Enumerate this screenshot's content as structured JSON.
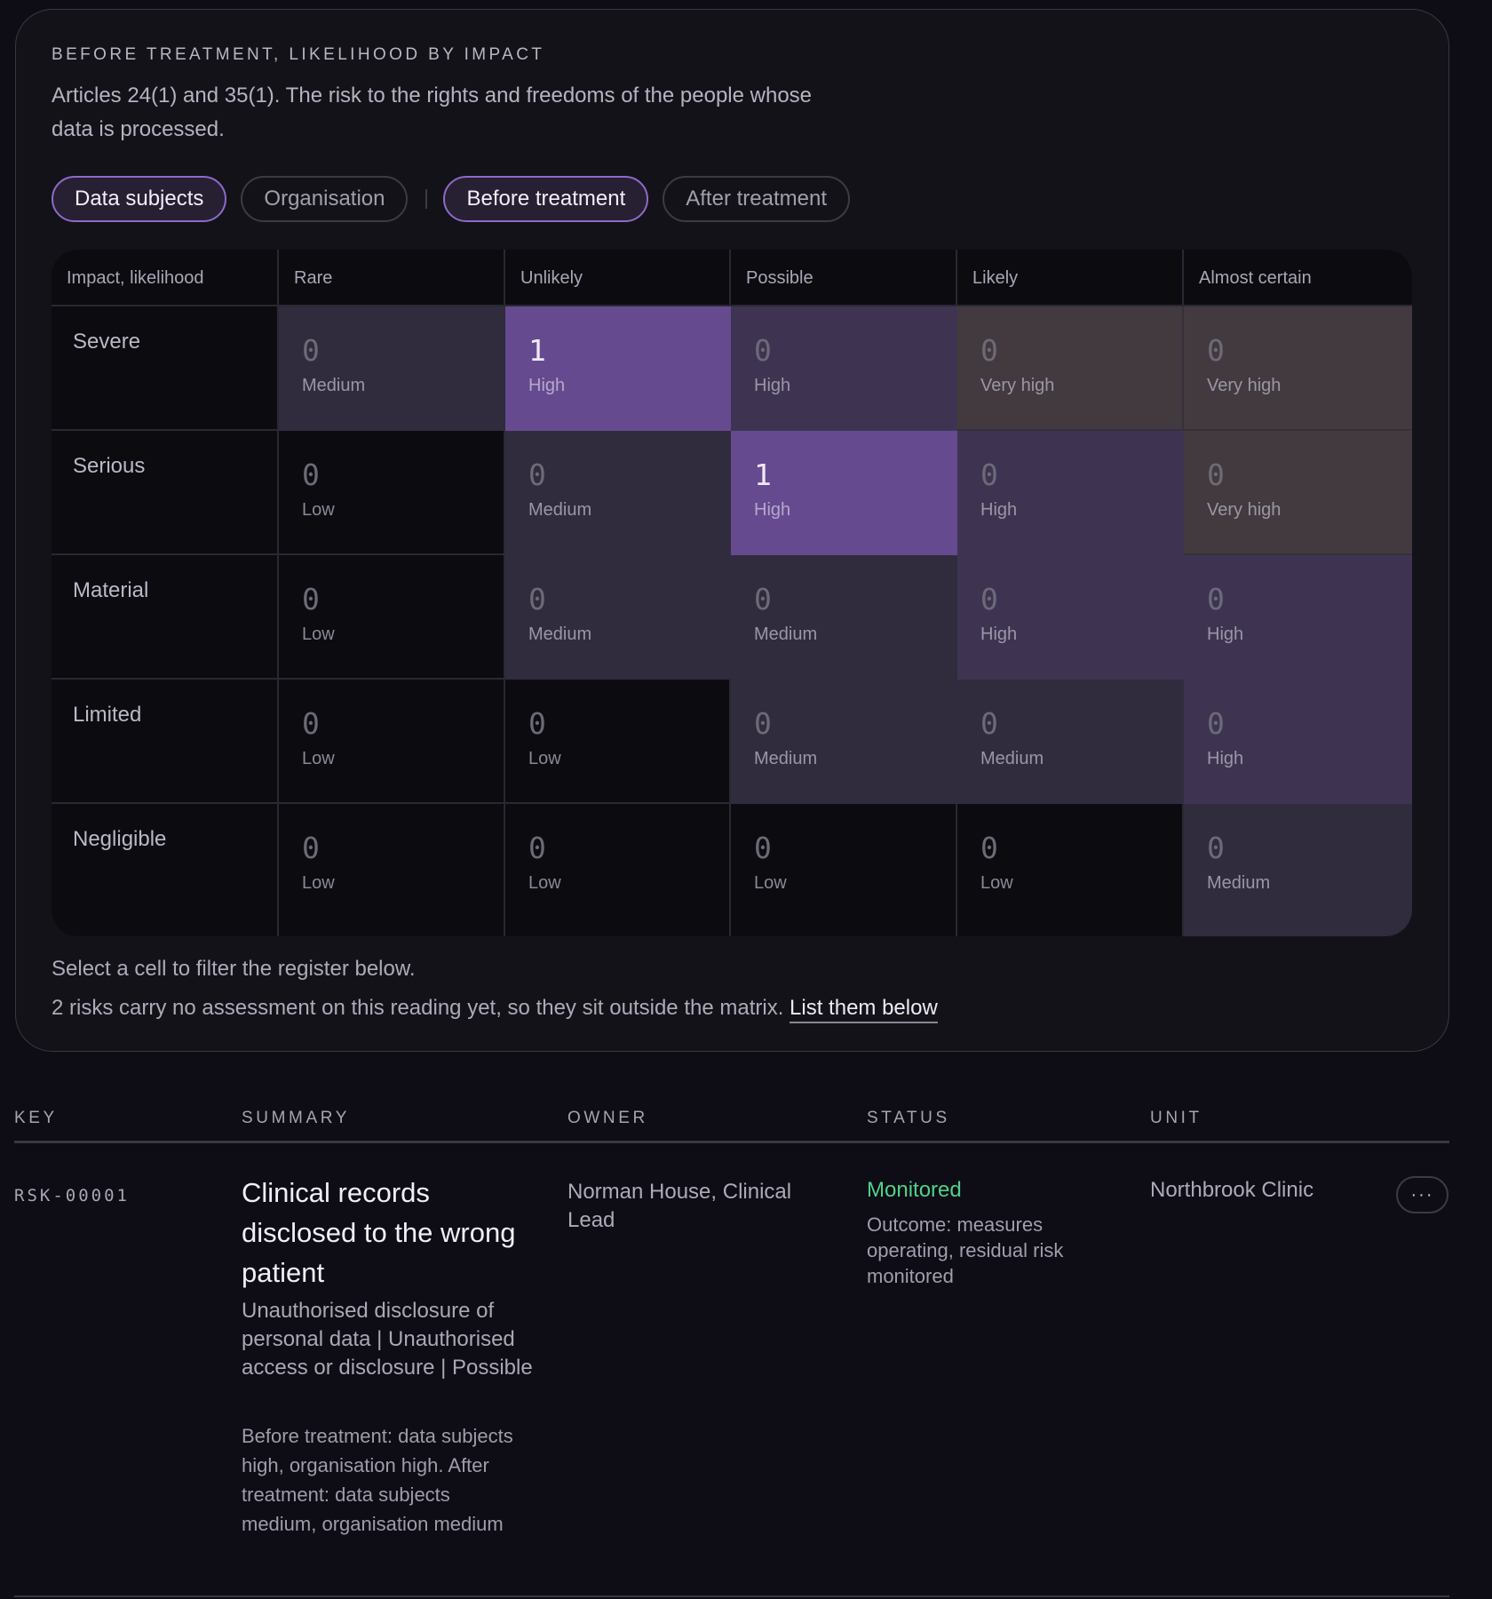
{
  "matrix_panel": {
    "eyebrow": "BEFORE TREATMENT, LIKELIHOOD BY IMPACT",
    "description": "Articles 24(1) and 35(1). The risk to the rights and freedoms of the people whose data is processed.",
    "pills": {
      "data_subjects": "Data subjects",
      "organisation": "Organisation",
      "before_treatment": "Before treatment",
      "after_treatment": "After treatment"
    },
    "corner_header": "Impact, likelihood",
    "columns": [
      "Rare",
      "Unlikely",
      "Possible",
      "Likely",
      "Almost certain"
    ],
    "rows": [
      {
        "impact": "Severe",
        "cells": [
          {
            "count": "0",
            "level": "Medium"
          },
          {
            "count": "1",
            "level": "High"
          },
          {
            "count": "0",
            "level": "High"
          },
          {
            "count": "0",
            "level": "Very high"
          },
          {
            "count": "0",
            "level": "Very high"
          }
        ]
      },
      {
        "impact": "Serious",
        "cells": [
          {
            "count": "0",
            "level": "Low"
          },
          {
            "count": "0",
            "level": "Medium"
          },
          {
            "count": "1",
            "level": "High"
          },
          {
            "count": "0",
            "level": "High"
          },
          {
            "count": "0",
            "level": "Very high"
          }
        ]
      },
      {
        "impact": "Material",
        "cells": [
          {
            "count": "0",
            "level": "Low"
          },
          {
            "count": "0",
            "level": "Medium"
          },
          {
            "count": "0",
            "level": "Medium"
          },
          {
            "count": "0",
            "level": "High"
          },
          {
            "count": "0",
            "level": "High"
          }
        ]
      },
      {
        "impact": "Limited",
        "cells": [
          {
            "count": "0",
            "level": "Low"
          },
          {
            "count": "0",
            "level": "Low"
          },
          {
            "count": "0",
            "level": "Medium"
          },
          {
            "count": "0",
            "level": "Medium"
          },
          {
            "count": "0",
            "level": "High"
          }
        ]
      },
      {
        "impact": "Negligible",
        "cells": [
          {
            "count": "0",
            "level": "Low"
          },
          {
            "count": "0",
            "level": "Low"
          },
          {
            "count": "0",
            "level": "Low"
          },
          {
            "count": "0",
            "level": "Low"
          },
          {
            "count": "0",
            "level": "Medium"
          }
        ]
      }
    ],
    "hint": "Select a cell to filter the register below.",
    "unassessed_text": "2 risks carry no assessment on this reading yet, so they sit outside the matrix.",
    "unassessed_link": "List them below"
  },
  "register": {
    "columns": {
      "key": "KEY",
      "summary": "SUMMARY",
      "owner": "OWNER",
      "status": "STATUS",
      "unit": "UNIT"
    },
    "rows": [
      {
        "key": "RSK-00001",
        "title": "Clinical records disclosed to the wrong patient",
        "subtitle": "Unauthorised disclosure of personal data | Unauthorised access or disclosure | Possible",
        "note": "Before treatment: data subjects high, organisation high. After treatment: data subjects medium, organisation medium",
        "owner": "Norman House, Clinical Lead",
        "status": "Monitored",
        "outcome": "Outcome: measures operating, residual risk monitored",
        "unit": "Northbrook Clinic",
        "more_label": "···"
      }
    ]
  },
  "colors": {
    "accent": "#8d6ac9",
    "hit_cell": "#664a8f",
    "status_monitored": "#4fd18a"
  }
}
